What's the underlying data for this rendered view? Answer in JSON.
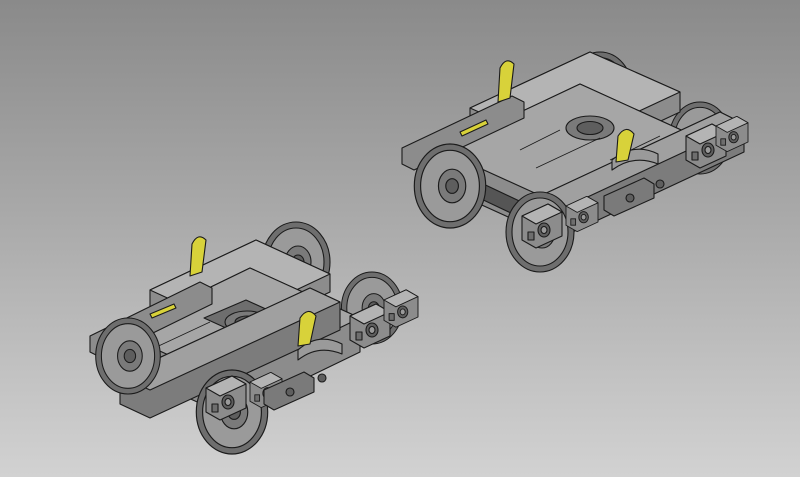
{
  "viewport": {
    "background_top": "#8a8a8a",
    "background_bottom": "#d2d2d2"
  },
  "model": {
    "body_color": "#8c8c8c",
    "body_dark": "#555555",
    "body_light": "#b4b4b4",
    "edge_color": "#1b1b1b",
    "highlight_color": "#d8d23a",
    "objects": [
      {
        "name": "bogie-left"
      },
      {
        "name": "bogie-right"
      }
    ]
  }
}
